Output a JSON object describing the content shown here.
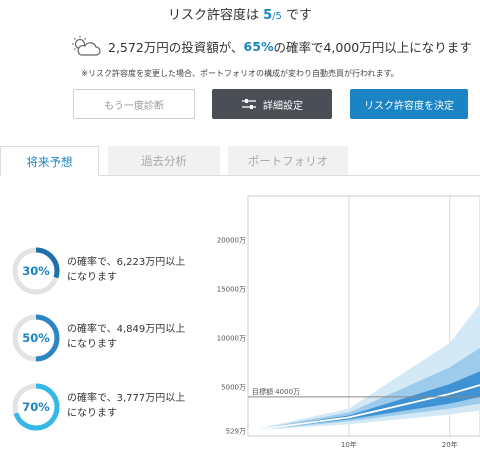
{
  "header": {
    "title_prefix": "リスク許容度は",
    "level": "5",
    "slash_max": "/5",
    "title_suffix": "です"
  },
  "forecast": {
    "icon": "partly-cloudy-icon",
    "prefix": "2,572万円の投資額が、",
    "probability": "65%",
    "suffix": "の確率で4,000万円以上になります"
  },
  "note": "※リスク許容度を変更した場合、ポートフォリオの構成が変わり自動売買が行われます。",
  "buttons": {
    "retry": "もう一度診断",
    "detail": "詳細設定",
    "decide": "リスク許容度を決定"
  },
  "tabs": [
    {
      "label": "将来予想",
      "active": true
    },
    {
      "label": "過去分析",
      "active": false
    },
    {
      "label": "ポートフォリオ",
      "active": false
    }
  ],
  "probabilities": [
    {
      "percent": "30%",
      "fraction": 0.3,
      "line1": "の確率で、6,223万円以上",
      "line2": "になります",
      "color": "#1f6fa9"
    },
    {
      "percent": "50%",
      "fraction": 0.5,
      "line1": "の確率で、4,849万円以上",
      "line2": "になります",
      "color": "#2b86c5"
    },
    {
      "percent": "70%",
      "fraction": 0.7,
      "line1": "の確率で、3,777万円以上",
      "line2": "になります",
      "color": "#35b7e8"
    }
  ],
  "chart_data": {
    "type": "area",
    "y_ticks": [
      "20000万",
      "15000万",
      "10000万",
      "5000万",
      "529万"
    ],
    "y_tick_values": [
      20000,
      15000,
      10000,
      5000,
      529
    ],
    "x_ticks": [
      "10年",
      "20年"
    ],
    "x_tick_values": [
      10,
      20
    ],
    "xlim": [
      0,
      23
    ],
    "ylim": [
      0,
      24500
    ],
    "target_label": "目標額 4000万",
    "target_value": 4000,
    "grid": true,
    "series": [
      {
        "x": [
          0,
          10,
          20,
          23
        ],
        "low": [
          529,
          1200,
          2200,
          2600
        ],
        "high": [
          529,
          2800,
          9500,
          13500
        ],
        "color": "#d4e9f6"
      },
      {
        "x": [
          0,
          10,
          20,
          23
        ],
        "low": [
          529,
          1500,
          2800,
          3300
        ],
        "high": [
          529,
          2400,
          7000,
          9000
        ],
        "color": "#9ccbeb"
      },
      {
        "x": [
          0,
          10,
          20,
          23
        ],
        "low": [
          529,
          1700,
          3300,
          4000
        ],
        "high": [
          529,
          2100,
          5300,
          6600
        ],
        "color": "#3f93d4"
      }
    ],
    "median": {
      "x": [
        0,
        10,
        20,
        23
      ],
      "y": [
        529,
        1900,
        4300,
        5200
      ]
    }
  }
}
